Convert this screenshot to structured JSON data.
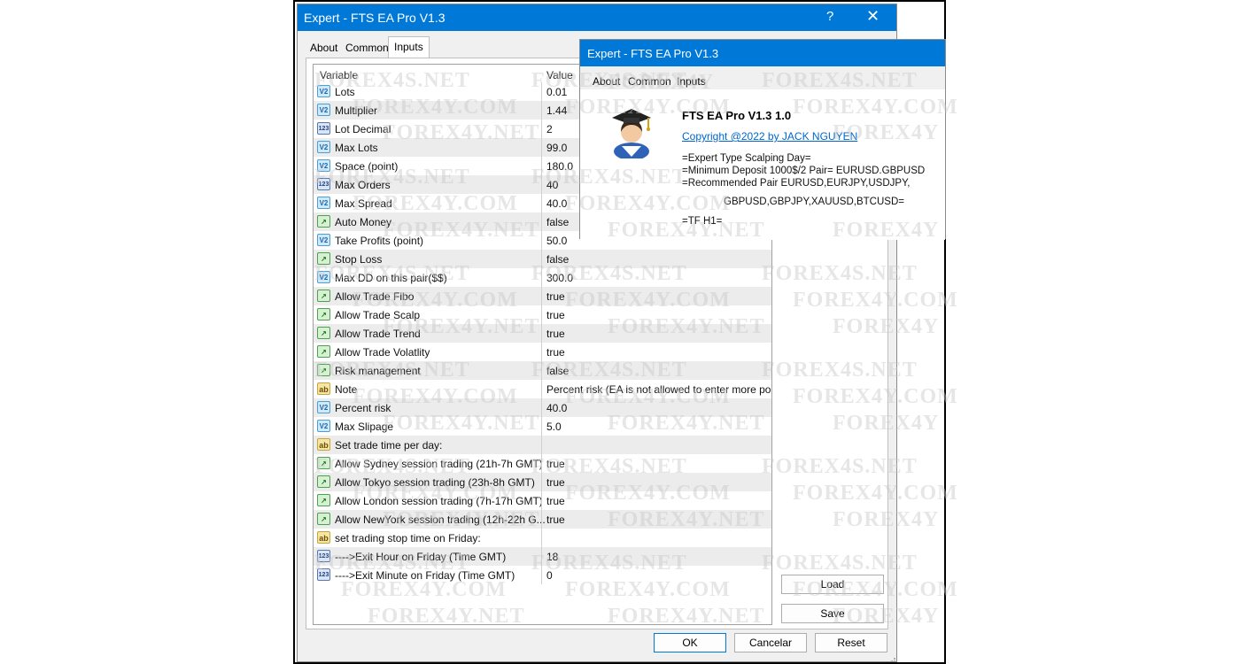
{
  "main_window": {
    "title": "Expert - FTS EA Pro V1.3",
    "help_glyph": "?",
    "close_glyph": "✕",
    "tabs": [
      {
        "label": "About"
      },
      {
        "label": "Common"
      },
      {
        "label": "Inputs"
      }
    ],
    "active_tab": "Inputs",
    "grid_headers": {
      "variable": "Variable",
      "value": "Value"
    },
    "rows": [
      {
        "icon": "double",
        "name": "Lots",
        "value": "0.01"
      },
      {
        "icon": "double",
        "name": "Multiplier",
        "value": "1.44"
      },
      {
        "icon": "integer",
        "name": "Lot Decimal",
        "value": "2"
      },
      {
        "icon": "double",
        "name": "Max Lots",
        "value": "99.0"
      },
      {
        "icon": "double",
        "name": "Space (point)",
        "value": "180.0"
      },
      {
        "icon": "integer",
        "name": "Max Orders",
        "value": "40"
      },
      {
        "icon": "double",
        "name": "Max Spread",
        "value": "40.0"
      },
      {
        "icon": "bool",
        "name": "Auto Money",
        "value": "false"
      },
      {
        "icon": "double",
        "name": "Take Profits (point)",
        "value": "50.0"
      },
      {
        "icon": "bool",
        "name": "Stop Loss",
        "value": "false"
      },
      {
        "icon": "double",
        "name": "Max DD on this pair($$)",
        "value": "300.0"
      },
      {
        "icon": "bool",
        "name": "Allow Trade Fibo",
        "value": "true"
      },
      {
        "icon": "bool",
        "name": "Allow Trade Scalp",
        "value": "true"
      },
      {
        "icon": "bool",
        "name": "Allow Trade Trend",
        "value": "true"
      },
      {
        "icon": "bool",
        "name": "Allow Trade Volatlity",
        "value": "true"
      },
      {
        "icon": "bool",
        "name": "Risk management",
        "value": "false"
      },
      {
        "icon": "string",
        "name": "Note",
        "value": "Percent risk (EA is not allowed to enter more pos..."
      },
      {
        "icon": "double",
        "name": "Percent risk",
        "value": "40.0"
      },
      {
        "icon": "double",
        "name": "Max Slipage",
        "value": "5.0"
      },
      {
        "icon": "string",
        "name": "Set trade time per day:",
        "value": ""
      },
      {
        "icon": "bool",
        "name": "Allow Sydney session trading (21h-7h GMT)",
        "value": "true"
      },
      {
        "icon": "bool",
        "name": "Allow Tokyo session trading (23h-8h GMT)",
        "value": "true"
      },
      {
        "icon": "bool",
        "name": "Allow London session trading (7h-17h GMT)",
        "value": "true"
      },
      {
        "icon": "bool",
        "name": "Allow NewYork session trading (12h-22h G...",
        "value": "true"
      },
      {
        "icon": "string",
        "name": "set trading stop time on Friday:",
        "value": ""
      },
      {
        "icon": "integer",
        "name": "---->Exit Hour on Friday (Time GMT)",
        "value": "18"
      },
      {
        "icon": "integer",
        "name": "---->Exit Minute on Friday (Time GMT)",
        "value": "0"
      }
    ],
    "side_buttons": {
      "load": "Load",
      "save": "Save"
    },
    "footer_buttons": {
      "ok": "OK",
      "cancel": "Cancelar",
      "reset": "Reset"
    }
  },
  "icon_glyphs": {
    "double": "V2",
    "integer": "123",
    "bool": "↗",
    "string": "ab"
  },
  "about_window": {
    "title": "Expert - FTS EA Pro V1.3",
    "tabs": [
      {
        "label": "About"
      },
      {
        "label": "Common"
      },
      {
        "label": "Inputs"
      }
    ],
    "product_title": "FTS EA Pro V1.3 1.0",
    "copyright_link": "Copyright @2022 by JACK NGUYEN",
    "lines": [
      "=Expert Type Scalping Day=",
      "=Minimum Deposit 1000$/2 Pair= EURUSD.GBPUSD",
      "=Recommended Pair EURUSD,EURJPY,USDJPY,",
      "GBPUSD,GBPJPY,XAUUSD,BTCUSD=",
      "=TF H1="
    ]
  },
  "watermarks": [
    "FOREX4S.NET",
    "FOREX4Y.COM",
    "FOREX4Y.NET",
    "FOREX4Y"
  ],
  "colors": {
    "titlebar": "#0078d7",
    "link": "#0066cc",
    "primary_button_border": "#0078d7"
  }
}
